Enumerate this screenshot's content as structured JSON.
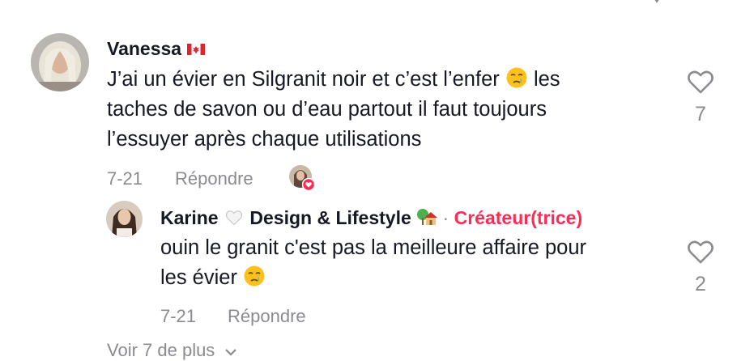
{
  "comment": {
    "author": "Vanessa",
    "author_flag": "canada-flag-icon",
    "text_line1": "J’ai un évier en Silgranit noir et c’est l’enfer",
    "text_line1_tail": "les",
    "text_line2": "taches de savon ou d’eau partout il faut toujours",
    "text_line3": "l’essuyer après chaque utilisations",
    "date": "7-21",
    "reply_label": "Répondre",
    "like_count": "7"
  },
  "reply": {
    "author": "Karine",
    "author_tail": "Design & Lifestyle",
    "separator": "·",
    "creator_label": "Créateur(trice)",
    "text_line1": "ouin le granit c'est pas la meilleure affaire pour",
    "text_line2": "les évier",
    "date": "7-21",
    "reply_label": "Répondre",
    "like_count": "2"
  },
  "more_replies": "Voir 7 de plus",
  "colors": {
    "text": "#161823",
    "muted": "#8a8b91",
    "accent": "#fe2c55"
  }
}
